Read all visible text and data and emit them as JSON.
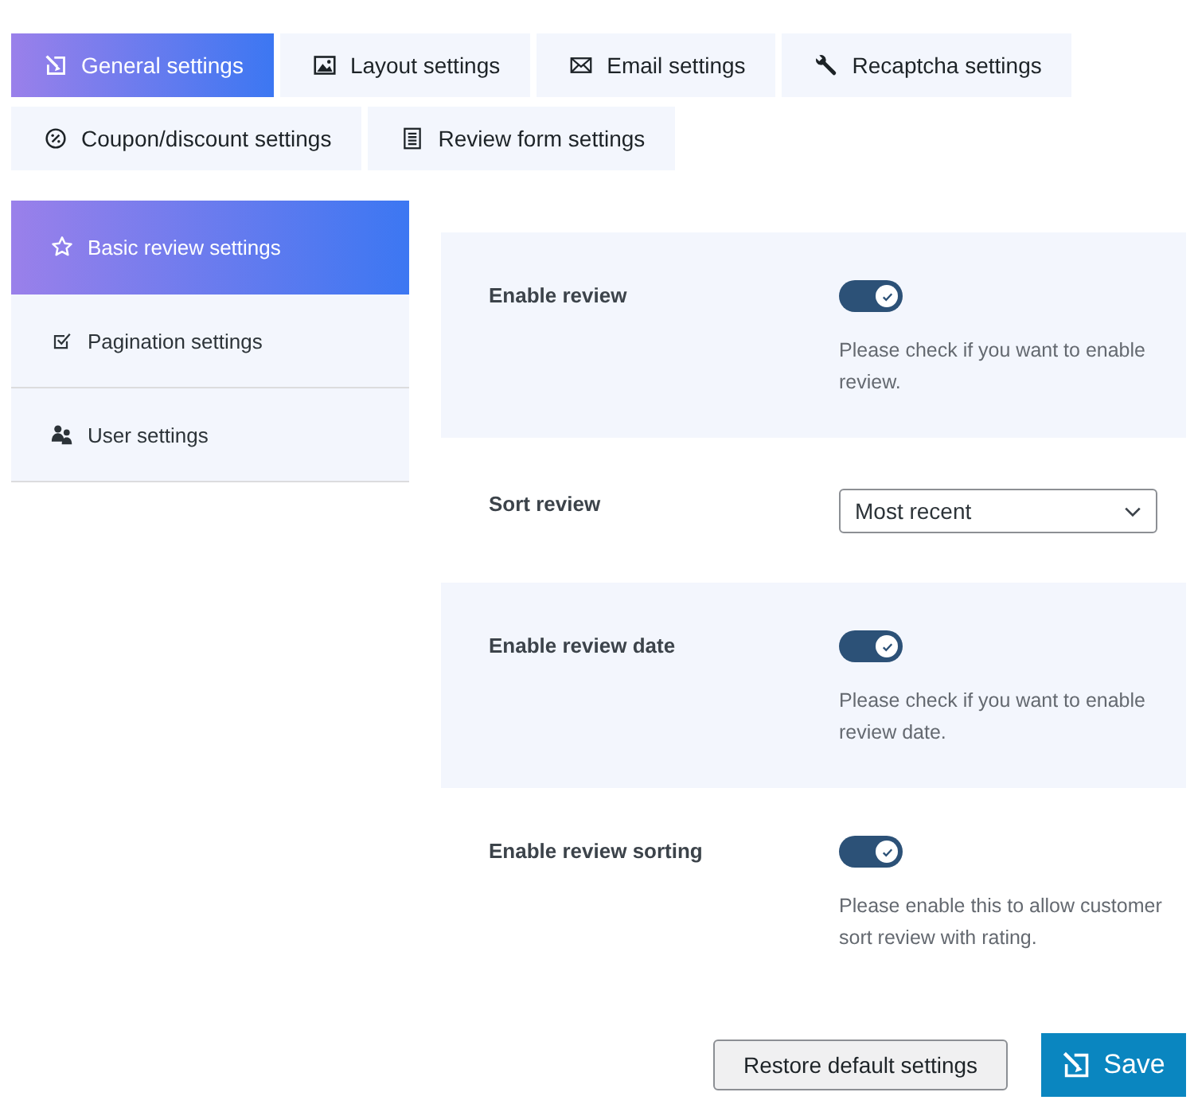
{
  "tabs": [
    {
      "label": "General settings",
      "selected": true
    },
    {
      "label": "Layout settings",
      "selected": false
    },
    {
      "label": "Email settings",
      "selected": false
    },
    {
      "label": "Recaptcha settings",
      "selected": false
    },
    {
      "label": "Coupon/discount settings",
      "selected": false
    },
    {
      "label": "Review form settings",
      "selected": false
    }
  ],
  "sidebar": {
    "items": [
      {
        "label": "Basic review settings",
        "selected": true
      },
      {
        "label": "Pagination settings",
        "selected": false
      },
      {
        "label": "User settings",
        "selected": false
      }
    ]
  },
  "settings": [
    {
      "kind": "toggle",
      "label": "Enable review",
      "on": true,
      "description": "Please check if you want to enable review."
    },
    {
      "kind": "select",
      "label": "Sort review",
      "value": "Most recent"
    },
    {
      "kind": "toggle",
      "label": "Enable review date",
      "on": true,
      "description": "Please check if you want to enable review date."
    },
    {
      "kind": "toggle",
      "label": "Enable review sorting",
      "on": true,
      "description": "Please enable this to allow customer sort review with rating."
    }
  ],
  "buttons": [
    {
      "kind": "secondary",
      "label": "Restore default settings"
    },
    {
      "kind": "primary",
      "label": "Save"
    }
  ]
}
